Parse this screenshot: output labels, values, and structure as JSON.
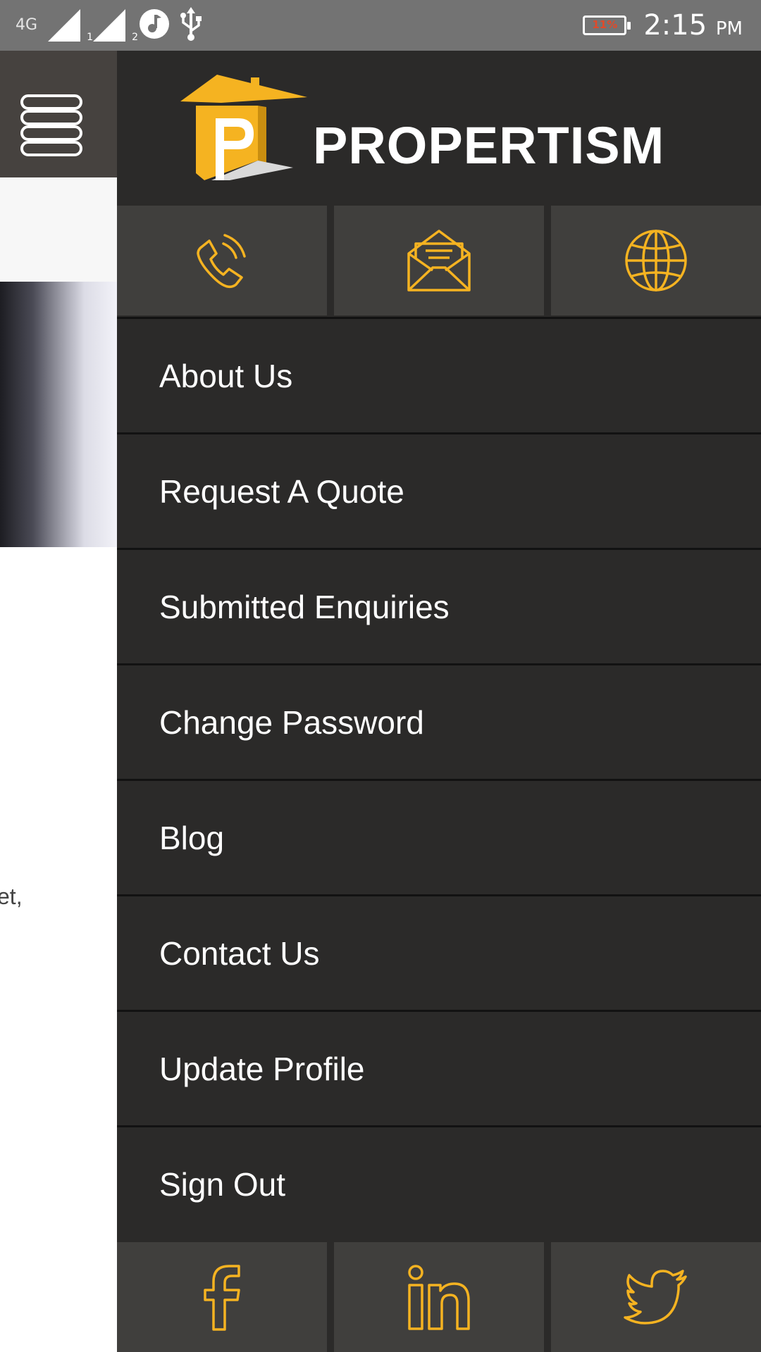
{
  "status_bar": {
    "network": "4G",
    "sim1_index": "1",
    "sim2_index": "2",
    "battery": "11%",
    "time": "2:15",
    "ampm": "PM",
    "icons": [
      "signal-icon",
      "music-icon",
      "usb-icon",
      "battery-icon"
    ]
  },
  "background_page": {
    "text_snippet": "et,"
  },
  "drawer": {
    "brand": "PROPERTISM",
    "accent_color": "#f5b321",
    "contact_icons": [
      "phone-icon",
      "email-icon",
      "globe-icon"
    ],
    "menu_items": [
      {
        "label": "About Us"
      },
      {
        "label": "Request A Quote"
      },
      {
        "label": "Submitted Enquiries"
      },
      {
        "label": "Change Password"
      },
      {
        "label": "Blog"
      },
      {
        "label": "Contact Us"
      },
      {
        "label": "Update Profile"
      },
      {
        "label": "Sign Out"
      }
    ],
    "social_icons": [
      "facebook-icon",
      "linkedin-icon",
      "twitter-icon"
    ]
  }
}
